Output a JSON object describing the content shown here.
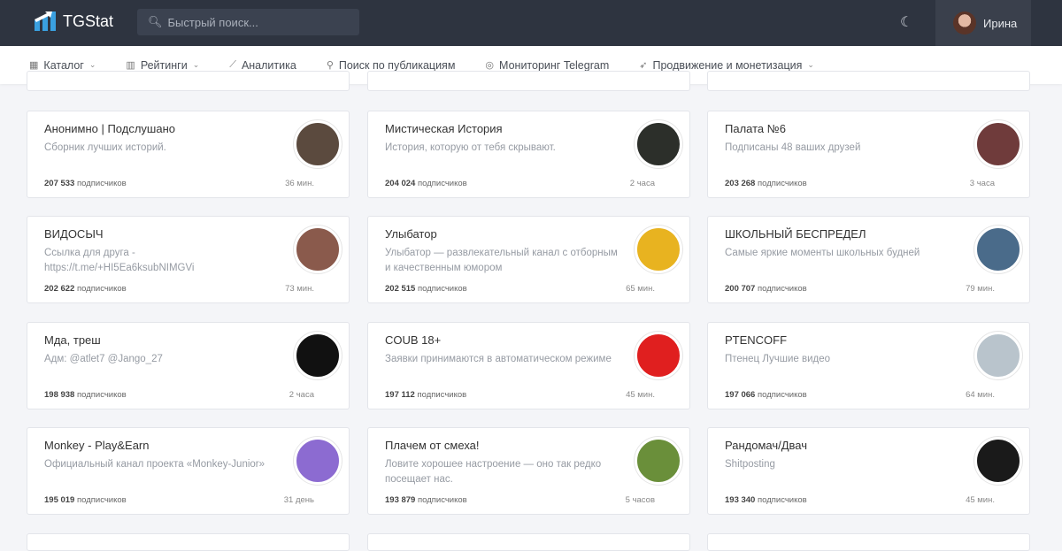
{
  "header": {
    "brand": "TGStat",
    "search_placeholder": "Быстрый поиск...",
    "user_name": "Ирина"
  },
  "nav": [
    {
      "label": "Каталог",
      "icon": "grid-icon",
      "dropdown": true
    },
    {
      "label": "Рейтинги",
      "icon": "chart-box-icon",
      "dropdown": true
    },
    {
      "label": "Аналитика",
      "icon": "line-chart-icon",
      "dropdown": false
    },
    {
      "label": "Поиск по публикациям",
      "icon": "search-icon",
      "dropdown": false
    },
    {
      "label": "Мониторинг Telegram",
      "icon": "monitor-icon",
      "dropdown": false
    },
    {
      "label": "Продвижение и монетизация",
      "icon": "rocket-icon",
      "dropdown": true
    }
  ],
  "subscribers_suffix": "подписчиков",
  "cards": [
    {
      "title": "Анонимно | Подслушано",
      "desc": "Сборник лучших историй.",
      "subs": "207 533",
      "time": "36 мин.",
      "color": "#5b4a3e"
    },
    {
      "title": "Мистическая История",
      "desc": "История, которую от тебя скрывают.",
      "subs": "204 024",
      "time": "2 часа",
      "color": "#2c2f2a"
    },
    {
      "title": "Палата №6",
      "desc": "Подписаны 48 ваших друзей",
      "subs": "203 268",
      "time": "3 часа",
      "color": "#6f3b3b"
    },
    {
      "title": "ВИДОСЫЧ",
      "desc": "Ссылка для друга - https://t.me/+HI5Ea6ksubNIMGVi",
      "subs": "202 622",
      "time": "73 мин.",
      "color": "#8a5a4c"
    },
    {
      "title": "Улыбатор",
      "desc": "Улыбатор — развлекательный канал с отборным и качественным юмором",
      "subs": "202 515",
      "time": "65 мин.",
      "color": "#e8b320"
    },
    {
      "title": "ШКОЛЬНЫЙ БЕСПРЕДЕЛ",
      "desc": "Самые яркие моменты школьных будней",
      "subs": "200 707",
      "time": "79 мин.",
      "color": "#4a6b8a"
    },
    {
      "title": "Мда, треш",
      "desc": "Адм: @atlet7 @Jango_27",
      "subs": "198 938",
      "time": "2 часа",
      "color": "#111111"
    },
    {
      "title": "COUB 18+",
      "desc": "Заявки принимаются в автоматическом режиме",
      "subs": "197 112",
      "time": "45 мин.",
      "color": "#e01f1f"
    },
    {
      "title": "PTENCOFF",
      "desc": "Птенец Лучшие видео",
      "subs": "197 066",
      "time": "64 мин.",
      "color": "#b9c4cc"
    },
    {
      "title": "Monkey - Play&Earn",
      "desc": "Официальный канал проекта «Monkey-Junior»",
      "subs": "195 019",
      "time": "31 день",
      "color": "#8c6bd1"
    },
    {
      "title": "Плачем от смеха!",
      "desc": "Ловите хорошее настроение — оно так редко посещает нас.",
      "subs": "193 879",
      "time": "5 часов",
      "color": "#6a8f3a"
    },
    {
      "title": "Рандомач/Двач",
      "desc": "Shitposting",
      "subs": "193 340",
      "time": "45 мин.",
      "color": "#1a1a1a"
    }
  ]
}
